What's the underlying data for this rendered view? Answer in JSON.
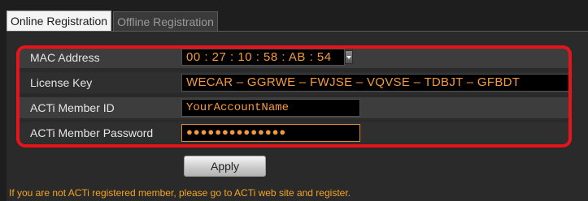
{
  "tabs": [
    {
      "label": "Online Registration",
      "active": true
    },
    {
      "label": "Offline Registration",
      "active": false
    }
  ],
  "form": {
    "mac_address": {
      "label": "MAC Address",
      "value": "00 : 27 : 10 : 58 : AB : 54"
    },
    "license_key": {
      "label": "License Key",
      "value": "WECAR – GGRWE – FWJSE  – VQVSE  – TDBJT   – GFBDT"
    },
    "member_id": {
      "label": "ACTi Member ID",
      "value": "YourAccountName"
    },
    "member_password": {
      "label": "ACTi Member Password",
      "value": "●●●●●●●●●●●●●●"
    }
  },
  "apply_label": "Apply",
  "notice": "If you are not ACTi registered member, please go to ACTi web site and register.",
  "icons": {
    "mac_dropdown": "dropdown-arrow-icon"
  },
  "colors": {
    "highlight_border": "#e8141c",
    "field_text": "#f59a3c",
    "notice_text": "#f5a422",
    "row_light": "#3d3d3d",
    "row_dark": "#2f2f2f"
  }
}
